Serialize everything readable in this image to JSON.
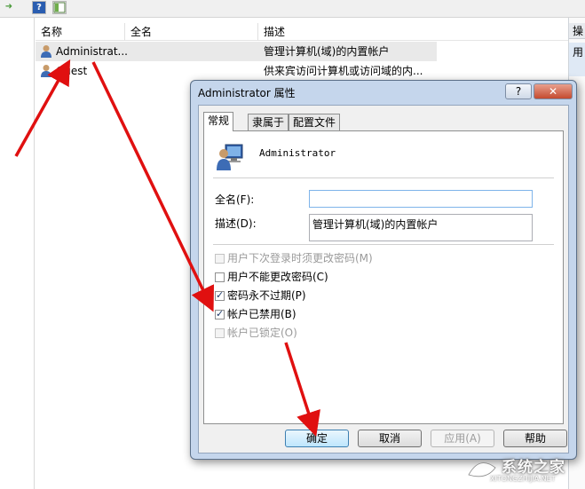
{
  "toolbar": {
    "buttons": [
      "export-list-icon",
      "help-icon",
      "show-hide-pane-icon"
    ],
    "help_glyph": "?"
  },
  "list": {
    "columns": [
      "名称",
      "全名",
      "描述"
    ],
    "rows": [
      {
        "name": "Administrat...",
        "fullname": "",
        "description": "管理计算机(域)的内置帐户",
        "selected": true
      },
      {
        "name": "Guest",
        "fullname": "",
        "description": "供来宾访问计算机或访问域的内..."
      }
    ]
  },
  "actions_pane": {
    "header": "操",
    "item": "用"
  },
  "dialog": {
    "title": "Administrator 属性",
    "help_button": "?",
    "close_button": "✕",
    "tabs": [
      "常规",
      "隶属于",
      "配置文件"
    ],
    "active_tab": 0,
    "user_name": "Administrator",
    "fullname_label": "全名(F):",
    "fullname_value": "",
    "description_label": "描述(D):",
    "description_value": "管理计算机(域)的内置帐户",
    "checkboxes": [
      {
        "label": "用户下次登录时须更改密码(M)",
        "checked": false,
        "disabled": true
      },
      {
        "label": "用户不能更改密码(C)",
        "checked": false,
        "disabled": false
      },
      {
        "label": "密码永不过期(P)",
        "checked": true,
        "disabled": false
      },
      {
        "label": "帐户已禁用(B)",
        "checked": true,
        "disabled": false
      },
      {
        "label": "帐户已锁定(O)",
        "checked": false,
        "disabled": true
      }
    ],
    "buttons": {
      "ok": "确定",
      "cancel": "取消",
      "apply": "应用(A)",
      "help": "帮助"
    }
  },
  "watermark": {
    "text": "系统之家",
    "sub": "XITONGZHIJIA.NET"
  },
  "colors": {
    "arrow": "#e01010",
    "dialog_frame": "#c5d6ec",
    "selected_row": "#e9e9e9"
  }
}
